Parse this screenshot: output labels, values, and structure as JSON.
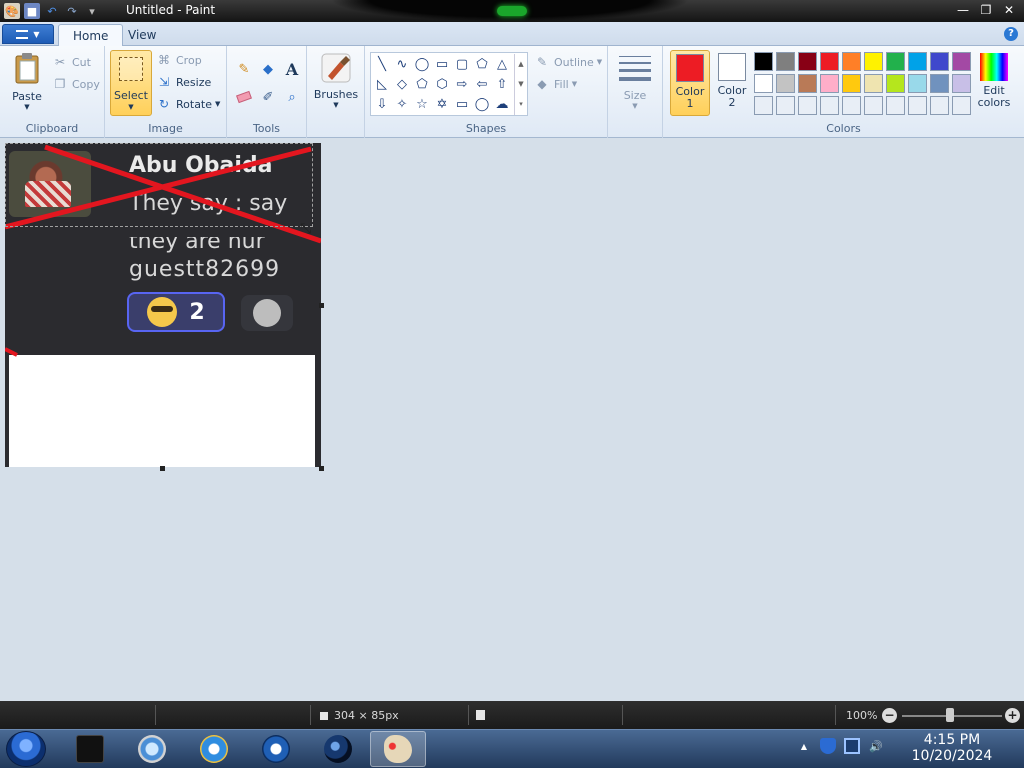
{
  "window": {
    "title": "Untitled - Paint",
    "minimize_symbol": "—",
    "maximize_symbol": "❐",
    "close_symbol": "✕"
  },
  "tabs": [
    {
      "label": "Home",
      "active": true
    },
    {
      "label": "View",
      "active": false
    }
  ],
  "app_menu_symbol": "▼",
  "help_symbol": "?",
  "clipboard": {
    "paste_label": "Paste",
    "cut_label": "Cut",
    "copy_label": "Copy",
    "group_label": "Clipboard"
  },
  "image_group": {
    "select_label": "Select",
    "crop_label": "Crop",
    "resize_label": "Resize",
    "rotate_label": "Rotate",
    "group_label": "Image"
  },
  "tools": {
    "group_label": "Tools",
    "text_tool_glyph": "A"
  },
  "brushes": {
    "label": "Brushes"
  },
  "shapes": {
    "group_label": "Shapes",
    "outline_label": "Outline",
    "fill_label": "Fill"
  },
  "size": {
    "label": "Size"
  },
  "colors": {
    "group_label": "Colors",
    "color1_label_line1": "Color",
    "color1_label_line2": "1",
    "color1_value": "#ed1c24",
    "color2_label_line1": "Color",
    "color2_label_line2": "2",
    "color2_value": "#ffffff",
    "edit_label_line1": "Edit",
    "edit_label_line2": "colors",
    "palette_row1": [
      "#000000",
      "#7f7f7f",
      "#880015",
      "#ed1c24",
      "#ff7f27",
      "#fff200",
      "#22b14c",
      "#00a2e8",
      "#3f48cc",
      "#a349a4"
    ],
    "palette_row2": [
      "#ffffff",
      "#c3c3c3",
      "#b97a57",
      "#ffaec9",
      "#ffc90e",
      "#efe4b0",
      "#b5e61d",
      "#99d9ea",
      "#7092be",
      "#c8bfe7"
    ],
    "palette_row3": [
      "#e8eef6",
      "#e8eef6",
      "#e8eef6",
      "#e8eef6",
      "#e8eef6",
      "#e8eef6",
      "#e8eef6",
      "#e8eef6",
      "#e8eef6",
      "#e8eef6"
    ]
  },
  "canvas": {
    "author_name": "Abu Obaida",
    "message_line1": "They say : say",
    "message_line2": "they are hur",
    "username": "guestt82699",
    "reaction_count": "2",
    "cross_color": "#e3161f"
  },
  "status": {
    "dimensions": "304 × 85px",
    "zoom": "100%",
    "zoom_out_symbol": "−",
    "zoom_in_symbol": "+"
  },
  "taskbar": {
    "clock_time": "4:15 PM",
    "clock_date": "10/20/2024",
    "tray_up_arrow": "▲"
  }
}
